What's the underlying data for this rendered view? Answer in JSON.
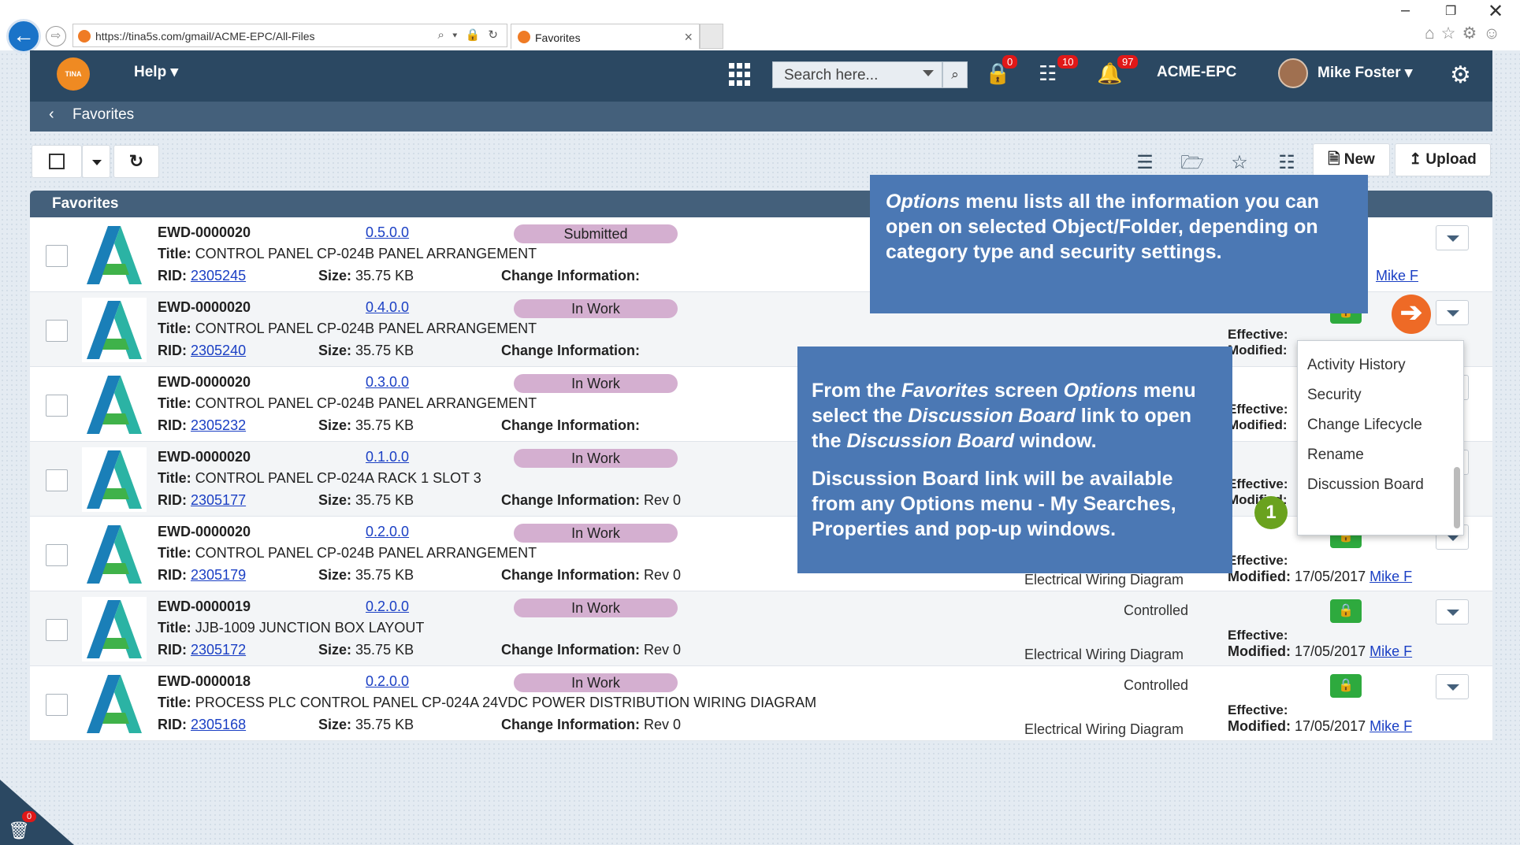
{
  "browser": {
    "url": "https://tina5s.com/gmail/ACME-EPC/All-Files",
    "tab_title": "Favorites",
    "addr_tools": "⌕ ▾ 🔒 ↻",
    "back": "←",
    "forward": "⇨",
    "tab_close": "×",
    "window_min": "–",
    "window_max": "❐",
    "window_close": "✕",
    "ie_icons": "⌂☆⚙☺"
  },
  "nav": {
    "logo": "TINA",
    "help": "Help ▾",
    "search_placeholder": "Search here...",
    "search_icon": "⌕",
    "lock_icon": "🔒",
    "lock_badge": "0",
    "org_icon": "☷",
    "org_badge": "10",
    "bell_icon": "🔔",
    "bell_badge": "97",
    "tenant": "ACME-EPC",
    "user": "Mike Foster ▾",
    "settings_icon": "⚙"
  },
  "breadcrumb": {
    "chevron": "‹",
    "label": "Favorites"
  },
  "toolbar": {
    "refresh": "↻",
    "icons": {
      "list": "☰",
      "folder": "🗁",
      "star": "☆",
      "doc": "☷"
    },
    "new": "🗎 New",
    "upload": "↥ Upload"
  },
  "panel": {
    "title": "Favorites"
  },
  "labels": {
    "title": "Title:",
    "rid": "RID:",
    "size": "Size:",
    "change": "Change Information:",
    "effective": "Effective:",
    "modified": "Modified:",
    "lock": "🔒"
  },
  "rows": [
    {
      "id": "EWD-0000020",
      "version": "0.5.0.0",
      "status": "Submitted",
      "title": "CONTROL PANEL CP-024B PANEL ARRANGEMENT",
      "rid": "2305245",
      "size": "35.75 KB",
      "change": "",
      "controlled": "",
      "category": "",
      "modified": "",
      "modified_by": "Mike F"
    },
    {
      "id": "EWD-0000020",
      "version": "0.4.0.0",
      "status": "In Work",
      "title": "CONTROL PANEL CP-024B PANEL ARRANGEMENT",
      "rid": "2305240",
      "size": "35.75 KB",
      "change": "",
      "controlled": "",
      "category": "",
      "modified": "",
      "modified_by": ""
    },
    {
      "id": "EWD-0000020",
      "version": "0.3.0.0",
      "status": "In Work",
      "title": "CONTROL PANEL CP-024B PANEL ARRANGEMENT",
      "rid": "2305232",
      "size": "35.75 KB",
      "change": "",
      "controlled": "",
      "category": "",
      "modified": "",
      "modified_by": ""
    },
    {
      "id": "EWD-0000020",
      "version": "0.1.0.0",
      "status": "In Work",
      "title": "CONTROL PANEL CP-024A RACK 1 SLOT 3",
      "rid": "2305177",
      "size": "35.75 KB",
      "change": "Rev 0",
      "controlled": "",
      "category": "",
      "modified": "",
      "modified_by": ""
    },
    {
      "id": "EWD-0000020",
      "version": "0.2.0.0",
      "status": "In Work",
      "title": "CONTROL PANEL CP-024B PANEL ARRANGEMENT",
      "rid": "2305179",
      "size": "35.75 KB",
      "change": "Rev 0",
      "controlled": "",
      "category": "Electrical Wiring Diagram",
      "modified": "17/05/2017",
      "modified_by": "Mike F"
    },
    {
      "id": "EWD-0000019",
      "version": "0.2.0.0",
      "status": "In Work",
      "title": "JJB-1009 JUNCTION BOX LAYOUT",
      "rid": "2305172",
      "size": "35.75 KB",
      "change": "Rev 0",
      "controlled": "Controlled",
      "category": "Electrical Wiring Diagram",
      "modified": "17/05/2017",
      "modified_by": "Mike F"
    },
    {
      "id": "EWD-0000018",
      "version": "0.2.0.0",
      "status": "In Work",
      "title": "PROCESS PLC CONTROL PANEL CP-024A 24VDC POWER DISTRIBUTION WIRING DIAGRAM",
      "rid": "2305168",
      "size": "35.75 KB",
      "change": "Rev 0",
      "controlled": "Controlled",
      "category": "Electrical Wiring Diagram",
      "modified": "17/05/2017",
      "modified_by": "Mike F"
    }
  ],
  "callouts": {
    "top_em": "Options",
    "top_rest": " menu lists all the information you can open on selected Object/Folder, depending on category type and security settings.",
    "main_1": "From the ",
    "main_em1": "Favorites",
    "main_2": " screen ",
    "main_em2": "Options",
    "main_3": " menu select the ",
    "main_em3": "Discussion Board",
    "main_4": " link to open the ",
    "main_em4": "Discussion Board",
    "main_5": " window.",
    "main_p2": "Discussion Board link will be available from any Options menu - My Searches, Properties and pop-up windows."
  },
  "arrow": "➔",
  "dropdown": {
    "items": [
      "Activity History",
      "Security",
      "Change Lifecycle",
      "Rename",
      "Discussion Board"
    ]
  },
  "step_badge": "1",
  "trash": {
    "icon": "🗑",
    "badge": "0"
  }
}
